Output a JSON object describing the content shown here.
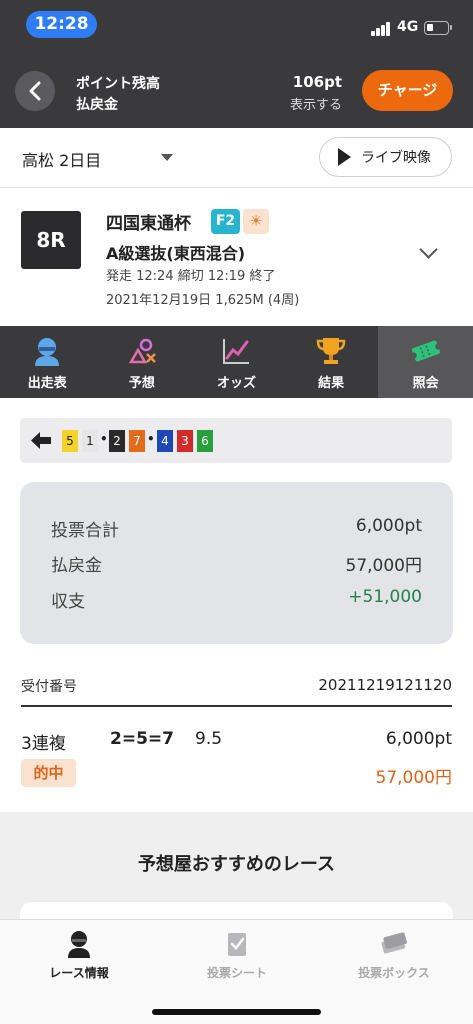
{
  "status_bar": {
    "time": "12:28",
    "network": "4G"
  },
  "header": {
    "points_label": "ポイント残高",
    "refund_label": "払戻金",
    "points_value": "106pt",
    "show_label": "表示する",
    "charge_button": "チャージ"
  },
  "venue": {
    "selected": "高松 2日目",
    "live_button": "ライブ映像"
  },
  "race": {
    "number": "8R",
    "name": "四国東通杯",
    "grade_badge": "F2",
    "class": "A級選抜(東西混合)",
    "times": "発走 12:24  締切 12:19  終了",
    "date_distance": "2021年12月19日 1,625M (4周)"
  },
  "tabs": [
    {
      "label": "出走表",
      "icon": "racer-icon"
    },
    {
      "label": "予想",
      "icon": "shapes-icon"
    },
    {
      "label": "オッズ",
      "icon": "chart-icon"
    },
    {
      "label": "結果",
      "icon": "trophy-icon"
    },
    {
      "label": "照会",
      "icon": "ticket-icon",
      "active": true
    }
  ],
  "result_combo": {
    "first": [
      "5",
      "1"
    ],
    "second": [
      "2",
      "7"
    ],
    "third": [
      "4",
      "3",
      "6"
    ]
  },
  "summary": {
    "rows": [
      {
        "label": "投票合計",
        "value": "6,000pt"
      },
      {
        "label": "払戻金",
        "value": "57,000円"
      },
      {
        "label": "収支",
        "value": "+51,000"
      }
    ]
  },
  "receipt": {
    "label": "受付番号",
    "number": "20211219121120",
    "bet_type": "3連複",
    "combination": "2=5=7",
    "odds": "9.5",
    "amount": "6,000pt",
    "hit_label": "的中",
    "payout": "57,000円"
  },
  "recommend": {
    "title": "予想屋おすすめのレース"
  },
  "bottom_nav": [
    {
      "label": "レース情報",
      "active": true
    },
    {
      "label": "投票シート",
      "active": false
    },
    {
      "label": "投票ボックス",
      "active": false
    }
  ],
  "colors": {
    "dark_bar": "#3a3a3c",
    "accent_orange": "#ec6a0d",
    "positive_green": "#23814a",
    "highlight_blue": "#2f7df6"
  }
}
